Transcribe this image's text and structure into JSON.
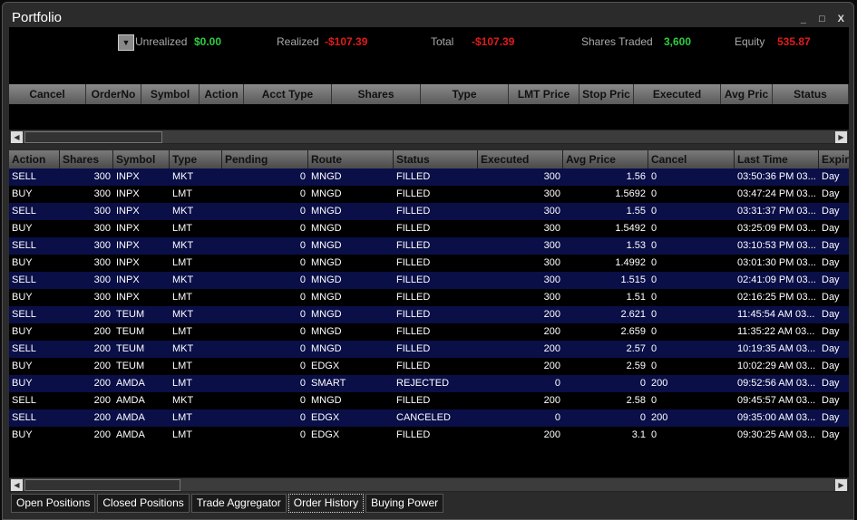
{
  "window": {
    "title": "Portfolio",
    "minimize": "_",
    "maximize": "□",
    "close": "X"
  },
  "summary": {
    "unrealized_label": "Unrealized",
    "unrealized": "$0.00",
    "realized_label": "Realized",
    "realized": "-$107.39",
    "total_label": "Total",
    "total": "-$107.39",
    "shares_traded_label": "Shares Traded",
    "shares_traded": "3,600",
    "equity_label": "Equity",
    "equity": "535.87"
  },
  "open_orders": {
    "columns": [
      "Cancel",
      "OrderNo",
      "Symbol",
      "Action",
      "Acct Type",
      "Shares",
      "Type",
      "LMT Price",
      "Stop Pric",
      "Executed",
      "Avg Pric",
      "Status"
    ]
  },
  "history": {
    "columns": [
      "Action",
      "Shares",
      "Symbol",
      "Type",
      "Pending",
      "Route",
      "Status",
      "Executed",
      "Avg Price",
      "Cancel",
      "Last Time",
      "Expir"
    ],
    "rows": [
      [
        "SELL",
        "300",
        "INPX",
        "MKT",
        "0",
        "MNGD",
        "FILLED",
        "300",
        "1.56",
        "0",
        "03:50:36 PM 03...",
        "Day"
      ],
      [
        "BUY",
        "300",
        "INPX",
        "LMT",
        "0",
        "MNGD",
        "FILLED",
        "300",
        "1.5692",
        "0",
        "03:47:24 PM 03...",
        "Day"
      ],
      [
        "SELL",
        "300",
        "INPX",
        "MKT",
        "0",
        "MNGD",
        "FILLED",
        "300",
        "1.55",
        "0",
        "03:31:37 PM 03...",
        "Day"
      ],
      [
        "BUY",
        "300",
        "INPX",
        "LMT",
        "0",
        "MNGD",
        "FILLED",
        "300",
        "1.5492",
        "0",
        "03:25:09 PM 03...",
        "Day"
      ],
      [
        "SELL",
        "300",
        "INPX",
        "MKT",
        "0",
        "MNGD",
        "FILLED",
        "300",
        "1.53",
        "0",
        "03:10:53 PM 03...",
        "Day"
      ],
      [
        "BUY",
        "300",
        "INPX",
        "LMT",
        "0",
        "MNGD",
        "FILLED",
        "300",
        "1.4992",
        "0",
        "03:01:30 PM 03...",
        "Day"
      ],
      [
        "SELL",
        "300",
        "INPX",
        "MKT",
        "0",
        "MNGD",
        "FILLED",
        "300",
        "1.515",
        "0",
        "02:41:09 PM 03...",
        "Day"
      ],
      [
        "BUY",
        "300",
        "INPX",
        "LMT",
        "0",
        "MNGD",
        "FILLED",
        "300",
        "1.51",
        "0",
        "02:16:25 PM 03...",
        "Day"
      ],
      [
        "SELL",
        "200",
        "TEUM",
        "MKT",
        "0",
        "MNGD",
        "FILLED",
        "200",
        "2.621",
        "0",
        "11:45:54 AM 03...",
        "Day"
      ],
      [
        "BUY",
        "200",
        "TEUM",
        "LMT",
        "0",
        "MNGD",
        "FILLED",
        "200",
        "2.659",
        "0",
        "11:35:22 AM 03...",
        "Day"
      ],
      [
        "SELL",
        "200",
        "TEUM",
        "MKT",
        "0",
        "MNGD",
        "FILLED",
        "200",
        "2.57",
        "0",
        "10:19:35 AM 03...",
        "Day"
      ],
      [
        "BUY",
        "200",
        "TEUM",
        "LMT",
        "0",
        "EDGX",
        "FILLED",
        "200",
        "2.59",
        "0",
        "10:02:29 AM 03...",
        "Day"
      ],
      [
        "BUY",
        "200",
        "AMDA",
        "LMT",
        "0",
        "SMART",
        "REJECTED",
        "0",
        "0",
        "200",
        "09:52:56 AM 03...",
        "Day"
      ],
      [
        "SELL",
        "200",
        "AMDA",
        "MKT",
        "0",
        "MNGD",
        "FILLED",
        "200",
        "2.58",
        "0",
        "09:45:57 AM 03...",
        "Day"
      ],
      [
        "SELL",
        "200",
        "AMDA",
        "LMT",
        "0",
        "EDGX",
        "CANCELED",
        "0",
        "0",
        "200",
        "09:35:00 AM 03...",
        "Day"
      ],
      [
        "BUY",
        "200",
        "AMDA",
        "LMT",
        "0",
        "EDGX",
        "FILLED",
        "200",
        "3.1",
        "0",
        "09:30:25 AM 03...",
        "Day"
      ]
    ]
  },
  "tabs": [
    {
      "label": "Open Positions"
    },
    {
      "label": "Closed Positions"
    },
    {
      "label": "Trade Aggregator"
    },
    {
      "label": "Order History",
      "active": true
    },
    {
      "label": "Buying Power"
    }
  ]
}
